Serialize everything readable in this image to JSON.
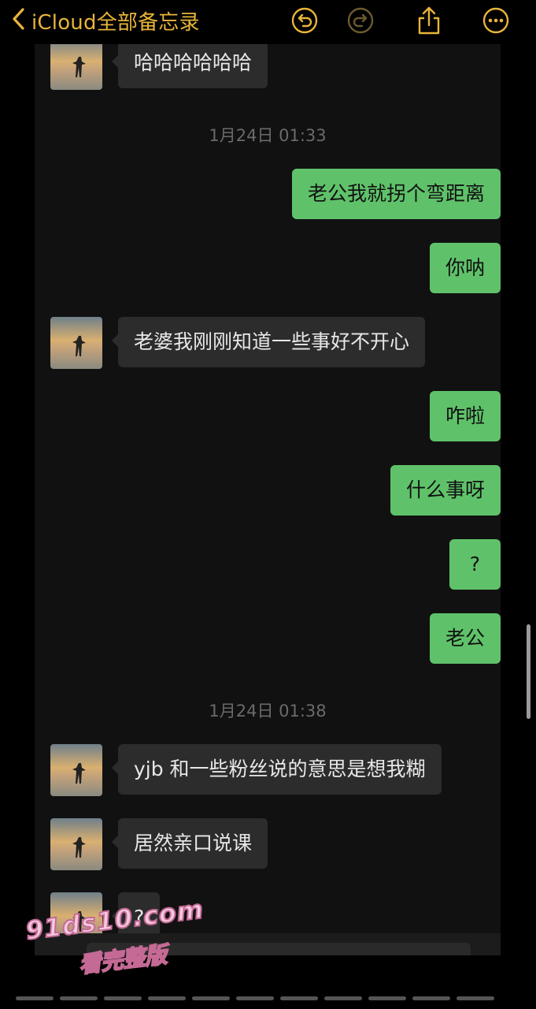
{
  "nav": {
    "back_title": "iCloud全部备忘录",
    "accent": "#e8b43a"
  },
  "chat": {
    "messages": [
      {
        "side": "in",
        "text": "哈哈哈哈哈哈"
      },
      {
        "type": "timestamp",
        "text": "1月24日 01:33"
      },
      {
        "side": "out",
        "text": "老公我就拐个弯距离"
      },
      {
        "side": "out",
        "text": "你呐"
      },
      {
        "side": "in",
        "text": "老婆我刚刚知道一些事好不开心"
      },
      {
        "side": "out",
        "text": "咋啦"
      },
      {
        "side": "out",
        "text": "什么事呀"
      },
      {
        "side": "out",
        "text": "?"
      },
      {
        "side": "out",
        "text": "老公"
      },
      {
        "type": "timestamp",
        "text": "1月24日 01:38"
      },
      {
        "side": "in",
        "text": "yjb 和一些粉丝说的意思是想我糊"
      },
      {
        "side": "in",
        "text": "居然亲口说课"
      },
      {
        "side": "in",
        "text": "?"
      }
    ],
    "bubble_out_color": "#5fc26a",
    "bubble_in_color": "#2c2c2c"
  },
  "watermark": {
    "line1": "91ds10.com",
    "line2": "看完整版"
  }
}
